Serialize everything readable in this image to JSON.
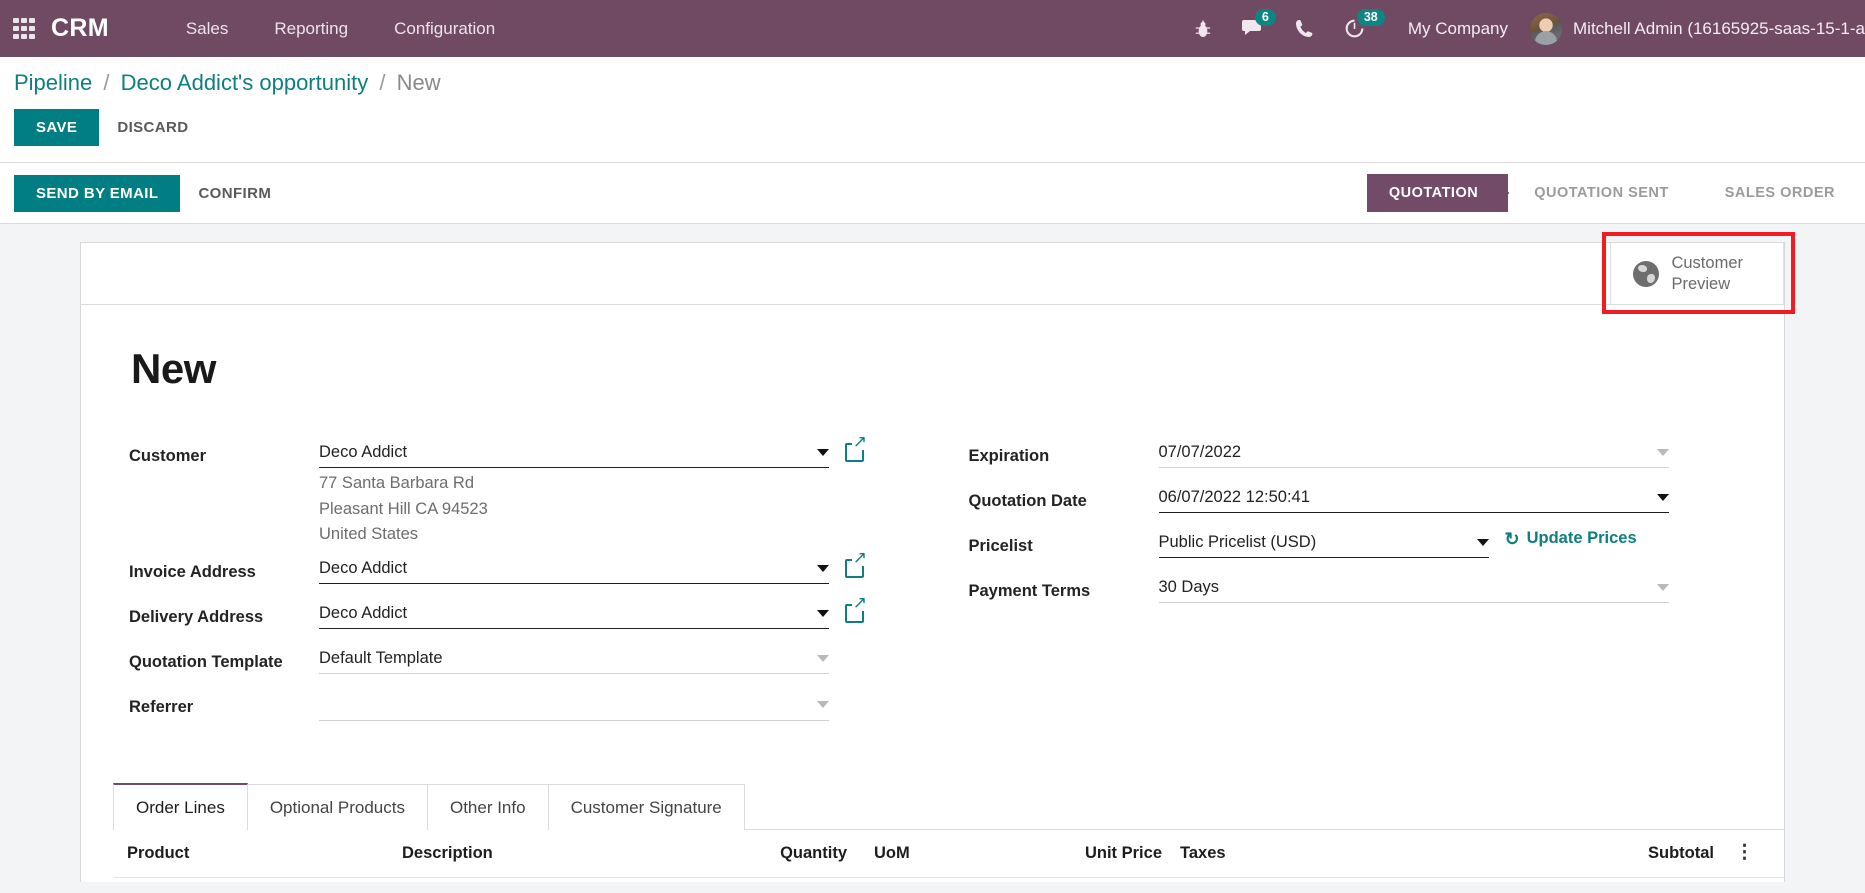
{
  "navbar": {
    "apps_icon": "apps-grid-icon",
    "brand": "CRM",
    "menu": [
      {
        "label": "Sales"
      },
      {
        "label": "Reporting"
      },
      {
        "label": "Configuration"
      }
    ],
    "icons": [
      {
        "name": "bug-icon",
        "glyph": "🐞",
        "badge": null
      },
      {
        "name": "messages-icon",
        "glyph": "💬",
        "badge": "6"
      },
      {
        "name": "phone-icon",
        "glyph": "📞",
        "badge": null
      },
      {
        "name": "activity-clock-icon",
        "glyph": "◔",
        "badge": "38"
      }
    ],
    "company": "My Company",
    "username": "Mitchell Admin (16165925-saas-15-1-a",
    "bg_color": "#6f4a62"
  },
  "breadcrumb": {
    "root": "Pipeline",
    "parent": "Deco Addict's opportunity",
    "current": "New",
    "separator": "/"
  },
  "control_panel": {
    "save_label": "SAVE",
    "discard_label": "DISCARD"
  },
  "statusbar_row": {
    "send_by_email_label": "SEND BY EMAIL",
    "confirm_label": "CONFIRM",
    "stages": [
      {
        "label": "QUOTATION",
        "active": true
      },
      {
        "label": "QUOTATION SENT",
        "active": false
      },
      {
        "label": "SALES ORDER",
        "active": false
      }
    ],
    "active_color": "#714b67"
  },
  "sheet": {
    "customer_preview": {
      "icon": "globe-icon",
      "line1": "Customer",
      "line2": "Preview",
      "highlight_color": "#ef1c24"
    },
    "record_title": "New",
    "left_fields": {
      "customer": {
        "label": "Customer",
        "value": "Deco Addict",
        "address": [
          "77 Santa Barbara Rd",
          "Pleasant Hill CA 94523",
          "United States"
        ]
      },
      "invoice_address": {
        "label": "Invoice Address",
        "value": "Deco Addict"
      },
      "delivery_address": {
        "label": "Delivery Address",
        "value": "Deco Addict"
      },
      "quotation_template": {
        "label": "Quotation Template",
        "value": "Default Template"
      },
      "referrer": {
        "label": "Referrer",
        "value": ""
      }
    },
    "right_fields": {
      "expiration": {
        "label": "Expiration",
        "value": "07/07/2022"
      },
      "quotation_date": {
        "label": "Quotation Date",
        "value": "06/07/2022 12:50:41"
      },
      "pricelist": {
        "label": "Pricelist",
        "value": "Public Pricelist (USD)",
        "action_label": "Update Prices",
        "action_icon": "sync-icon"
      },
      "payment_terms": {
        "label": "Payment Terms",
        "value": "30 Days"
      }
    },
    "notebook": {
      "tabs": [
        {
          "label": "Order Lines",
          "active": true
        },
        {
          "label": "Optional Products",
          "active": false
        },
        {
          "label": "Other Info",
          "active": false
        },
        {
          "label": "Customer Signature",
          "active": false
        }
      ],
      "columns": {
        "product": "Product",
        "description": "Description",
        "quantity": "Quantity",
        "uom": "UoM",
        "unit_price": "Unit Price",
        "taxes": "Taxes",
        "subtotal": "Subtotal",
        "options_icon": "⋮"
      }
    }
  },
  "theme": {
    "primary": "#017e84",
    "purple": "#714b67",
    "link": "#0e7f80"
  }
}
